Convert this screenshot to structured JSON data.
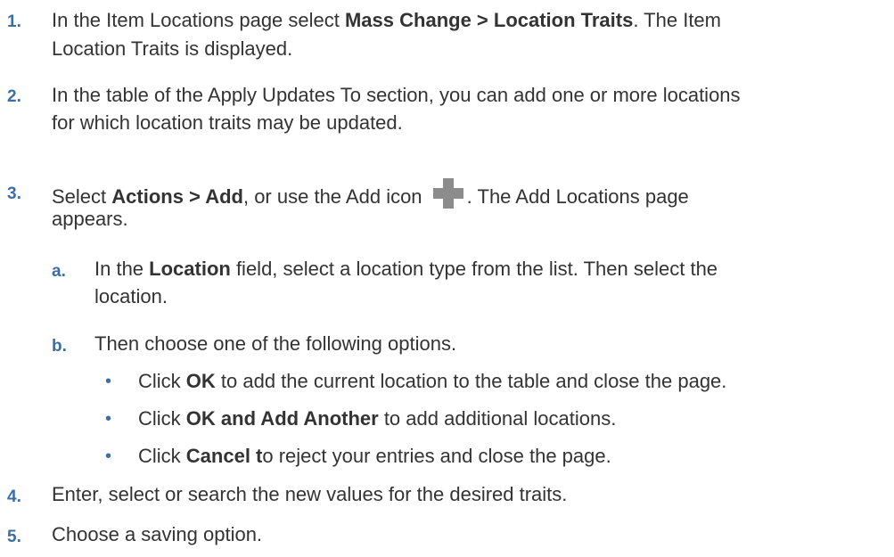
{
  "steps": [
    {
      "num": "1.",
      "pre": "In the Item Locations page select ",
      "bold": "Mass Change > Location Traits",
      "post": ". The Item",
      "line2": "Location Traits is displayed."
    },
    {
      "num": "2.",
      "line1": "In the table of the Apply Updates To section, you can add one or more locations",
      "line2": "for which location traits may be updated."
    },
    {
      "num": "3.",
      "pre": "Select ",
      "bold": "Actions > Add",
      "mid": ", or use the Add icon ",
      "post": ". The Add Locations page",
      "line2": "appears.",
      "icon": "add-icon"
    },
    {
      "num": "4.",
      "line1": "Enter, select or search the new values for the desired traits."
    },
    {
      "num": "5.",
      "line1": "Choose a saving option."
    }
  ],
  "substeps": [
    {
      "num": "a.",
      "pre": "In the ",
      "bold": "Location",
      "post": " field, select a location type from the list. Then select the",
      "line2": "location."
    },
    {
      "num": "b.",
      "line1": "Then choose one of the following options."
    }
  ],
  "bullets": [
    {
      "symbol": "•",
      "pre": "Click ",
      "bold": "OK",
      "post": " to add the current location to the table and close the page."
    },
    {
      "symbol": "•",
      "pre": "Click ",
      "bold": "OK and Add Another",
      "post": " to add additional locations."
    },
    {
      "symbol": "•",
      "pre": "Click ",
      "bold": "Cancel t",
      "post": "o reject your entries and close the page."
    }
  ],
  "colors": {
    "number": "#3a6ea5",
    "text": "#333333",
    "icon": "#8c8c8c"
  }
}
